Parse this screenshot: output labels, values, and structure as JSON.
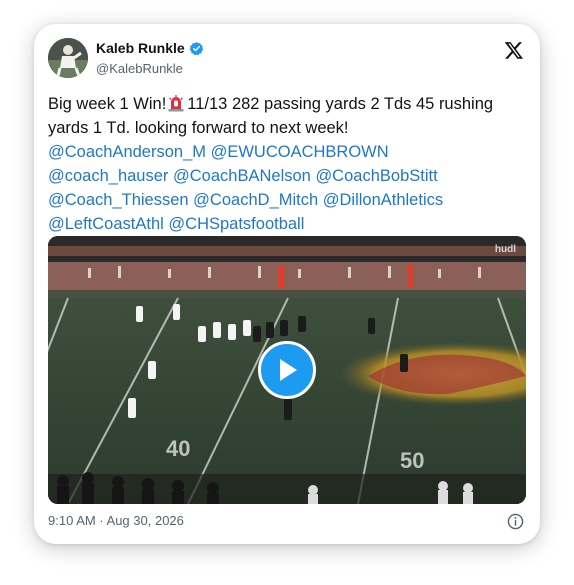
{
  "author": {
    "name": "Kaleb Runkle",
    "handle": "@KalebRunkle"
  },
  "tweet": {
    "text_start": "Big week 1 Win!",
    "text_rest": "11/13 282 passing yards 2 Tds 45 rushing yards 1 Td. looking forward to next week!",
    "mentions": [
      "@CoachAnderson_M",
      "@EWUCOACHBROWN",
      "@coach_hauser",
      "@CoachBANelson",
      "@CoachBobStitt",
      "@Coach_Thiessen",
      "@CoachD_Mitch",
      "@DillonAthletics",
      "@LeftCoastAthl",
      "@CHSpatsfootball"
    ]
  },
  "media": {
    "watermark": "hudl",
    "field_numbers": [
      "40",
      "50"
    ]
  },
  "footer": {
    "timestamp": "9:10 AM · Aug 30, 2026"
  },
  "colors": {
    "accent": "#1d9bf0",
    "mention": "#1d78c9",
    "text": "#0f1419",
    "muted": "#536471"
  },
  "icons": {
    "verified": "verified-badge-icon",
    "platform": "x-logo-icon",
    "emoji": "police-light-emoji",
    "play": "play-icon",
    "info": "info-icon"
  }
}
